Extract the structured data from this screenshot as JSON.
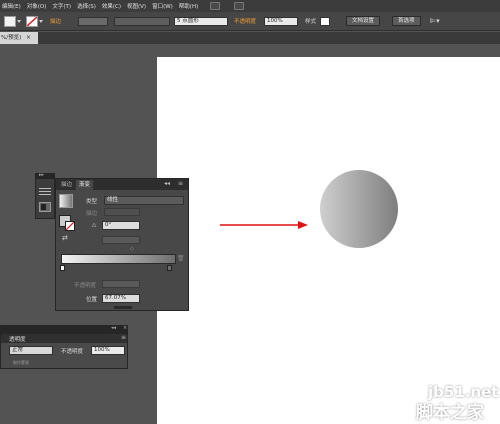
{
  "menu": {
    "items": [
      "编辑(E)",
      "对象(O)",
      "文字(T)",
      "选择(S)",
      "效果(C)",
      "视图(V)",
      "窗口(W)",
      "帮助(H)"
    ]
  },
  "controlbar": {
    "stroke_label": "描边",
    "brush_value": "5 点圆形",
    "opacity_label": "不透明度",
    "opacity_value": "100%",
    "style_label": "样式",
    "doc_setup_button": "文档设置",
    "preferences_button": "首选项"
  },
  "document_tab": {
    "label": "%/预览)",
    "close": "×"
  },
  "gradient_panel": {
    "tab_stroke": "描边",
    "tab_gradient": "渐变",
    "type_label": "类型",
    "type_value": "线性",
    "stroke_label": "描边",
    "angle_symbol": "△",
    "angle_value": "0°",
    "opacity_label": "不透明度",
    "location_label": "位置",
    "location_value": "67.07%",
    "stop_marker": "◇"
  },
  "transparency_panel": {
    "title": "透明度",
    "blend_mode": "正常",
    "opacity_label": "不透明度",
    "opacity_value": "100%",
    "sublabel": "制作蒙版"
  },
  "watermark": {
    "url": "jb51.net",
    "text": "脚本之家"
  },
  "colors": {
    "workspace": "#535353",
    "artboard": "#ffffff",
    "arrow": "#dd1111",
    "orange_label": "#f0a032",
    "gradient_start": "#cfcfcf",
    "gradient_end": "#7e7e7e"
  },
  "icons": [
    "selection-tool-icon",
    "fill-swatch-icon",
    "stroke-none-icon",
    "close-icon",
    "gradient-icon"
  ]
}
